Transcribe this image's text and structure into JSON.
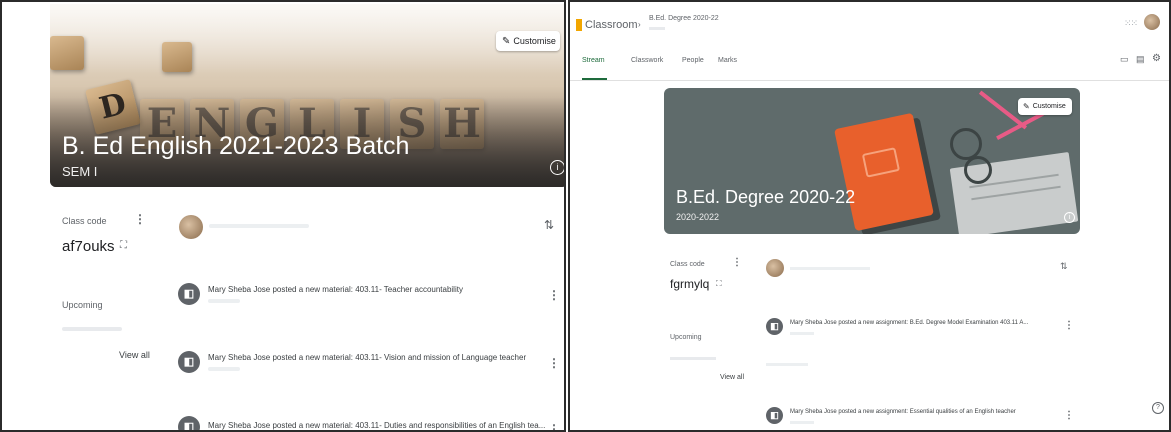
{
  "left": {
    "banner": {
      "title": "B. Ed English 2021-2023 Batch",
      "subtitle": "SEM I",
      "customise_label": "Customise",
      "dice_letters": [
        "E",
        "N",
        "G",
        "L",
        "I",
        "S",
        "H"
      ]
    },
    "class_code": {
      "label": "Class code",
      "value": "af7ouks"
    },
    "upcoming": {
      "label": "Upcoming",
      "view_all": "View all"
    },
    "posts": [
      {
        "text": "Mary Sheba Jose posted a new material: 403.11- Teacher accountability"
      },
      {
        "text": "Mary Sheba Jose posted a new material: 403.11- Vision and mission of Language teacher"
      },
      {
        "text": "Mary Sheba Jose posted a new material: 403.11- Duties and responsibilities of an English tea..."
      }
    ]
  },
  "right": {
    "app": {
      "brand": "Classroom",
      "class_name": "B.Ed. Degree 2020-22"
    },
    "tabs": [
      {
        "label": "Stream"
      },
      {
        "label": "Classwork"
      },
      {
        "label": "People"
      },
      {
        "label": "Marks"
      }
    ],
    "banner": {
      "title": "B.Ed. Degree 2020-22",
      "subtitle": "2020-2022",
      "customise_label": "Customise"
    },
    "class_code": {
      "label": "Class code",
      "value": "fgrmylq"
    },
    "upcoming": {
      "label": "Upcoming",
      "view_all": "View all"
    },
    "posts": [
      {
        "text": "Mary Sheba Jose posted a new assignment: B.Ed. Degree Model Examination 403.11 A..."
      },
      {
        "text": "Mary Sheba Jose posted a new assignment: Essential qualities of an English teacher"
      }
    ]
  },
  "colors": {
    "accent_green": "#1e6b3c",
    "book_orange": "#e8602c",
    "glasses_pink": "#e85b86",
    "banner_grey": "#5f6b6b"
  }
}
